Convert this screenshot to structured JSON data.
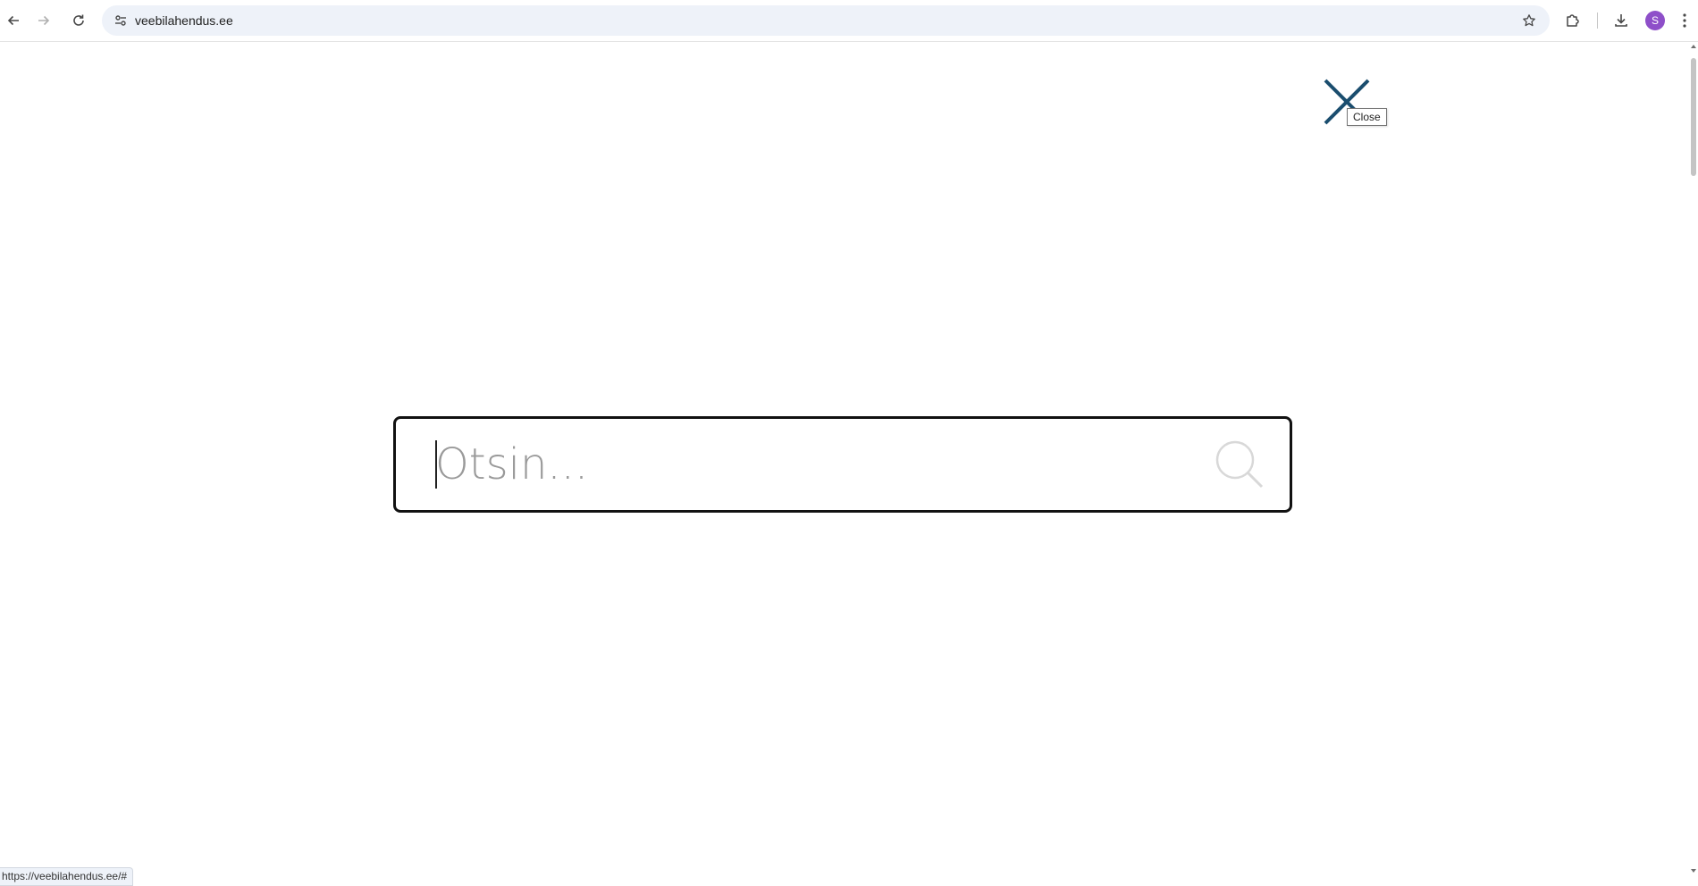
{
  "browser": {
    "url": "veebilahendus.ee",
    "profile_initial": "S",
    "profile_color": "#8e4fc9",
    "buttons": {
      "back": "arrow-left-icon",
      "forward": "arrow-right-icon",
      "reload": "reload-icon",
      "site_info": "tune-icon",
      "bookmark": "star-icon",
      "extensions": "puzzle-icon",
      "downloads": "download-icon",
      "menu": "kebab-menu-icon"
    }
  },
  "overlay": {
    "close_tooltip": "Close",
    "close_color": "#1a4d6e",
    "search": {
      "placeholder": "Otsin...",
      "value": ""
    }
  },
  "status_bar": {
    "link": "https://veebilahendus.ee/#"
  }
}
